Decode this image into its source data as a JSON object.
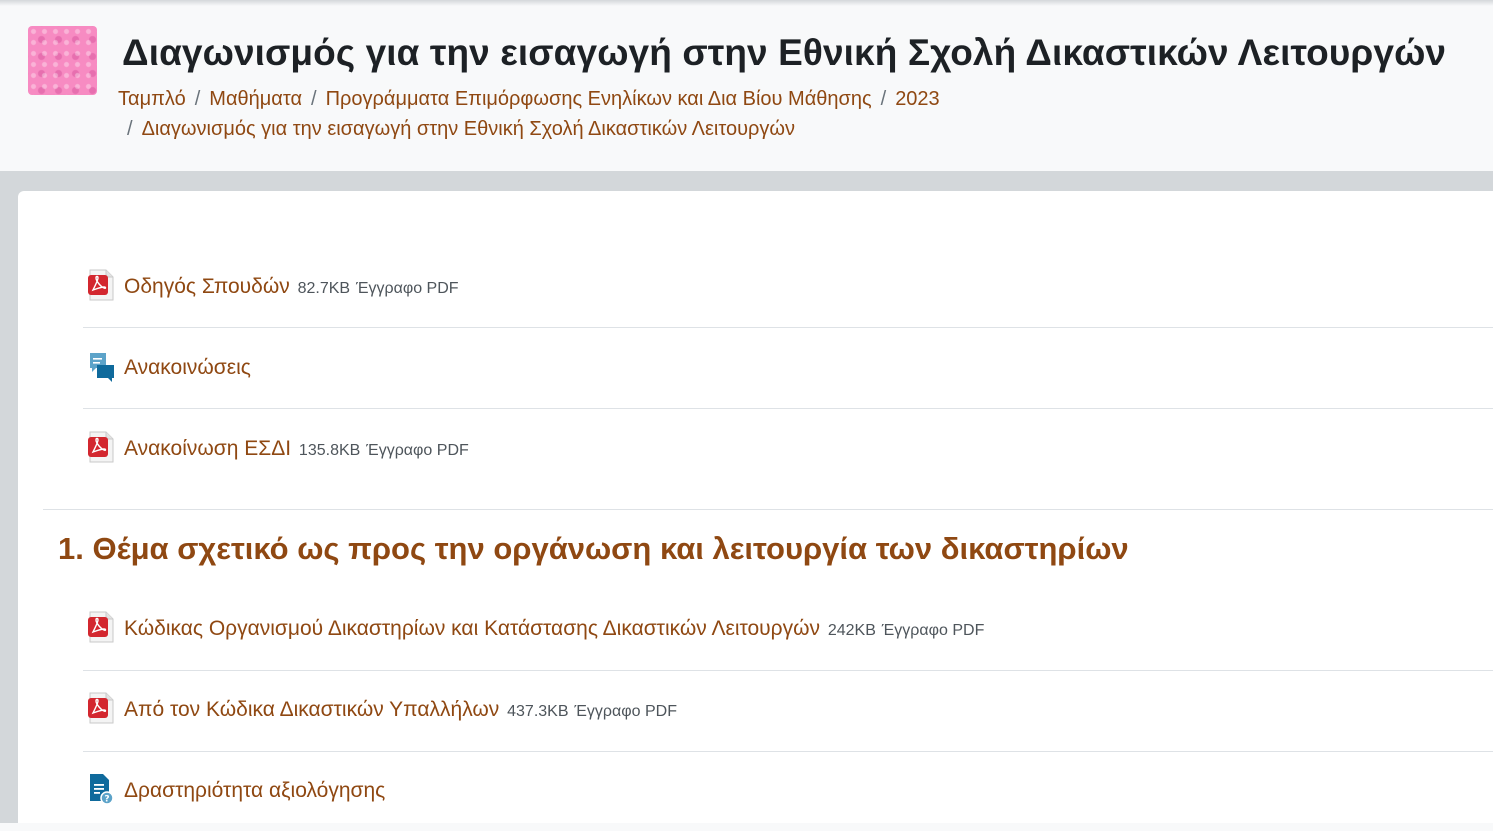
{
  "header": {
    "title": "Διαγωνισμός για την εισαγωγή στην Εθνική Σχολή Δικαστικών Λειτουργών",
    "course_image_alt": "course-image",
    "breadcrumb": [
      "Ταμπλό",
      "Μαθήματα",
      "Προγράμματα Επιμόρφωσης Ενηλίκων και Δια Βίου Μάθησης",
      "2023",
      "Διαγωνισμός για την εισαγωγή στην Εθνική Σχολή Δικαστικών Λειτουργών"
    ],
    "separator": "/"
  },
  "general_section": {
    "activities": [
      {
        "name": "Οδηγός Σπουδών",
        "size": "82.7KB",
        "type": "Έγγραφο PDF",
        "icon": "pdf-icon"
      },
      {
        "name": "Ανακοινώσεις",
        "size": "",
        "type": "",
        "icon": "forum-icon"
      },
      {
        "name": "Ανακοίνωση ΕΣΔΙ",
        "size": "135.8KB",
        "type": "Έγγραφο PDF",
        "icon": "pdf-icon"
      }
    ]
  },
  "section1": {
    "title": "1. Θέμα σχετικό ως προς την οργάνωση και λειτουργία των δικαστηρίων",
    "activities": [
      {
        "name": "Κώδικας Οργανισμού Δικαστηρίων και Κατάστασης Δικαστικών Λειτουργών",
        "size": "242KB",
        "type": "Έγγραφο PDF",
        "icon": "pdf-icon"
      },
      {
        "name": "Από τον Κώδικα Δικαστικών Υπαλλήλων",
        "size": "437.3KB",
        "type": "Έγγραφο PDF",
        "icon": "pdf-icon"
      },
      {
        "name": "Δραστηριότητα αξιολόγησης",
        "size": "",
        "type": "",
        "icon": "quiz-icon"
      }
    ]
  },
  "colors": {
    "link": "#8f4812",
    "title": "#1d2125",
    "band": "#d3d7da",
    "pdf_red": "#d3272f",
    "forum_blue": "#0f6a9c"
  }
}
